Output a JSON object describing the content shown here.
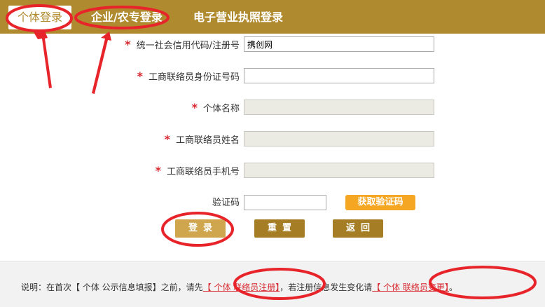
{
  "tabs": {
    "personal": "个体登录",
    "enterprise": "企业/农专登录",
    "license": "电子营业执照登录"
  },
  "form": {
    "credit_code": {
      "label": "统一社会信用代码/注册号",
      "value": "携创网"
    },
    "liaison_id": {
      "label": "工商联络员身份证号码",
      "value": ""
    },
    "entity_name": {
      "label": "个体名称",
      "value": ""
    },
    "liaison_name": {
      "label": "工商联络员姓名",
      "value": ""
    },
    "liaison_phone": {
      "label": "工商联络员手机号",
      "value": ""
    },
    "captcha": {
      "label": "验证码",
      "value": ""
    },
    "required_mark": "*"
  },
  "buttons": {
    "get_code": "获取验证码",
    "login": "登录",
    "reset": "重置",
    "back": "返回"
  },
  "footer": {
    "prefix": "说明：在首次【 个体 公示信息填报】之前，请先",
    "link_register": "【 个体 联络员注册】",
    "middle": "，若注册信息发生变化请",
    "link_change": "【 个体 联络员变更】",
    "suffix": "。"
  },
  "colors": {
    "header": "#b08a2e",
    "required": "#d7282f",
    "sms_button": "#f5a623",
    "annotation": "#e8242b"
  }
}
